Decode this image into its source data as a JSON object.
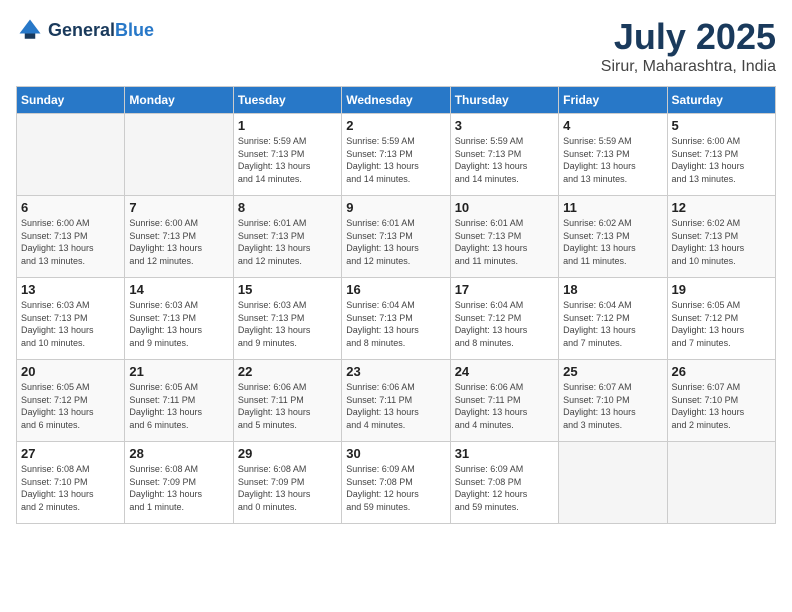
{
  "header": {
    "logo_general": "General",
    "logo_blue": "Blue",
    "month": "July 2025",
    "location": "Sirur, Maharashtra, India"
  },
  "days_of_week": [
    "Sunday",
    "Monday",
    "Tuesday",
    "Wednesday",
    "Thursday",
    "Friday",
    "Saturday"
  ],
  "weeks": [
    [
      {
        "day": "",
        "info": ""
      },
      {
        "day": "",
        "info": ""
      },
      {
        "day": "1",
        "info": "Sunrise: 5:59 AM\nSunset: 7:13 PM\nDaylight: 13 hours\nand 14 minutes."
      },
      {
        "day": "2",
        "info": "Sunrise: 5:59 AM\nSunset: 7:13 PM\nDaylight: 13 hours\nand 14 minutes."
      },
      {
        "day": "3",
        "info": "Sunrise: 5:59 AM\nSunset: 7:13 PM\nDaylight: 13 hours\nand 14 minutes."
      },
      {
        "day": "4",
        "info": "Sunrise: 5:59 AM\nSunset: 7:13 PM\nDaylight: 13 hours\nand 13 minutes."
      },
      {
        "day": "5",
        "info": "Sunrise: 6:00 AM\nSunset: 7:13 PM\nDaylight: 13 hours\nand 13 minutes."
      }
    ],
    [
      {
        "day": "6",
        "info": "Sunrise: 6:00 AM\nSunset: 7:13 PM\nDaylight: 13 hours\nand 13 minutes."
      },
      {
        "day": "7",
        "info": "Sunrise: 6:00 AM\nSunset: 7:13 PM\nDaylight: 13 hours\nand 12 minutes."
      },
      {
        "day": "8",
        "info": "Sunrise: 6:01 AM\nSunset: 7:13 PM\nDaylight: 13 hours\nand 12 minutes."
      },
      {
        "day": "9",
        "info": "Sunrise: 6:01 AM\nSunset: 7:13 PM\nDaylight: 13 hours\nand 12 minutes."
      },
      {
        "day": "10",
        "info": "Sunrise: 6:01 AM\nSunset: 7:13 PM\nDaylight: 13 hours\nand 11 minutes."
      },
      {
        "day": "11",
        "info": "Sunrise: 6:02 AM\nSunset: 7:13 PM\nDaylight: 13 hours\nand 11 minutes."
      },
      {
        "day": "12",
        "info": "Sunrise: 6:02 AM\nSunset: 7:13 PM\nDaylight: 13 hours\nand 10 minutes."
      }
    ],
    [
      {
        "day": "13",
        "info": "Sunrise: 6:03 AM\nSunset: 7:13 PM\nDaylight: 13 hours\nand 10 minutes."
      },
      {
        "day": "14",
        "info": "Sunrise: 6:03 AM\nSunset: 7:13 PM\nDaylight: 13 hours\nand 9 minutes."
      },
      {
        "day": "15",
        "info": "Sunrise: 6:03 AM\nSunset: 7:13 PM\nDaylight: 13 hours\nand 9 minutes."
      },
      {
        "day": "16",
        "info": "Sunrise: 6:04 AM\nSunset: 7:13 PM\nDaylight: 13 hours\nand 8 minutes."
      },
      {
        "day": "17",
        "info": "Sunrise: 6:04 AM\nSunset: 7:12 PM\nDaylight: 13 hours\nand 8 minutes."
      },
      {
        "day": "18",
        "info": "Sunrise: 6:04 AM\nSunset: 7:12 PM\nDaylight: 13 hours\nand 7 minutes."
      },
      {
        "day": "19",
        "info": "Sunrise: 6:05 AM\nSunset: 7:12 PM\nDaylight: 13 hours\nand 7 minutes."
      }
    ],
    [
      {
        "day": "20",
        "info": "Sunrise: 6:05 AM\nSunset: 7:12 PM\nDaylight: 13 hours\nand 6 minutes."
      },
      {
        "day": "21",
        "info": "Sunrise: 6:05 AM\nSunset: 7:11 PM\nDaylight: 13 hours\nand 6 minutes."
      },
      {
        "day": "22",
        "info": "Sunrise: 6:06 AM\nSunset: 7:11 PM\nDaylight: 13 hours\nand 5 minutes."
      },
      {
        "day": "23",
        "info": "Sunrise: 6:06 AM\nSunset: 7:11 PM\nDaylight: 13 hours\nand 4 minutes."
      },
      {
        "day": "24",
        "info": "Sunrise: 6:06 AM\nSunset: 7:11 PM\nDaylight: 13 hours\nand 4 minutes."
      },
      {
        "day": "25",
        "info": "Sunrise: 6:07 AM\nSunset: 7:10 PM\nDaylight: 13 hours\nand 3 minutes."
      },
      {
        "day": "26",
        "info": "Sunrise: 6:07 AM\nSunset: 7:10 PM\nDaylight: 13 hours\nand 2 minutes."
      }
    ],
    [
      {
        "day": "27",
        "info": "Sunrise: 6:08 AM\nSunset: 7:10 PM\nDaylight: 13 hours\nand 2 minutes."
      },
      {
        "day": "28",
        "info": "Sunrise: 6:08 AM\nSunset: 7:09 PM\nDaylight: 13 hours\nand 1 minute."
      },
      {
        "day": "29",
        "info": "Sunrise: 6:08 AM\nSunset: 7:09 PM\nDaylight: 13 hours\nand 0 minutes."
      },
      {
        "day": "30",
        "info": "Sunrise: 6:09 AM\nSunset: 7:08 PM\nDaylight: 12 hours\nand 59 minutes."
      },
      {
        "day": "31",
        "info": "Sunrise: 6:09 AM\nSunset: 7:08 PM\nDaylight: 12 hours\nand 59 minutes."
      },
      {
        "day": "",
        "info": ""
      },
      {
        "day": "",
        "info": ""
      }
    ]
  ]
}
